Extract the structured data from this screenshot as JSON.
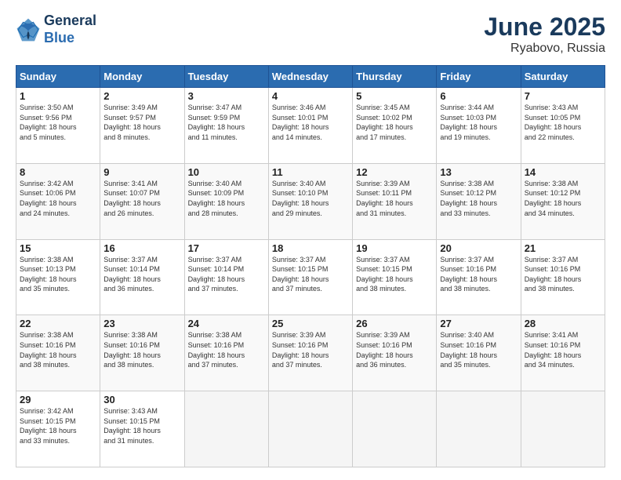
{
  "header": {
    "logo_line1": "General",
    "logo_line2": "Blue",
    "main_title": "June 2025",
    "subtitle": "Ryabovo, Russia"
  },
  "days_of_week": [
    "Sunday",
    "Monday",
    "Tuesday",
    "Wednesday",
    "Thursday",
    "Friday",
    "Saturday"
  ],
  "weeks": [
    [
      {
        "day": "1",
        "sunrise": "3:50 AM",
        "sunset": "9:56 PM",
        "daylight": "18 hours and 5 minutes."
      },
      {
        "day": "2",
        "sunrise": "3:49 AM",
        "sunset": "9:57 PM",
        "daylight": "18 hours and 8 minutes."
      },
      {
        "day": "3",
        "sunrise": "3:47 AM",
        "sunset": "9:59 PM",
        "daylight": "18 hours and 11 minutes."
      },
      {
        "day": "4",
        "sunrise": "3:46 AM",
        "sunset": "10:01 PM",
        "daylight": "18 hours and 14 minutes."
      },
      {
        "day": "5",
        "sunrise": "3:45 AM",
        "sunset": "10:02 PM",
        "daylight": "18 hours and 17 minutes."
      },
      {
        "day": "6",
        "sunrise": "3:44 AM",
        "sunset": "10:03 PM",
        "daylight": "18 hours and 19 minutes."
      },
      {
        "day": "7",
        "sunrise": "3:43 AM",
        "sunset": "10:05 PM",
        "daylight": "18 hours and 22 minutes."
      }
    ],
    [
      {
        "day": "8",
        "sunrise": "3:42 AM",
        "sunset": "10:06 PM",
        "daylight": "18 hours and 24 minutes."
      },
      {
        "day": "9",
        "sunrise": "3:41 AM",
        "sunset": "10:07 PM",
        "daylight": "18 hours and 26 minutes."
      },
      {
        "day": "10",
        "sunrise": "3:40 AM",
        "sunset": "10:09 PM",
        "daylight": "18 hours and 28 minutes."
      },
      {
        "day": "11",
        "sunrise": "3:40 AM",
        "sunset": "10:10 PM",
        "daylight": "18 hours and 29 minutes."
      },
      {
        "day": "12",
        "sunrise": "3:39 AM",
        "sunset": "10:11 PM",
        "daylight": "18 hours and 31 minutes."
      },
      {
        "day": "13",
        "sunrise": "3:38 AM",
        "sunset": "10:12 PM",
        "daylight": "18 hours and 33 minutes."
      },
      {
        "day": "14",
        "sunrise": "3:38 AM",
        "sunset": "10:12 PM",
        "daylight": "18 hours and 34 minutes."
      }
    ],
    [
      {
        "day": "15",
        "sunrise": "3:38 AM",
        "sunset": "10:13 PM",
        "daylight": "18 hours and 35 minutes."
      },
      {
        "day": "16",
        "sunrise": "3:37 AM",
        "sunset": "10:14 PM",
        "daylight": "18 hours and 36 minutes."
      },
      {
        "day": "17",
        "sunrise": "3:37 AM",
        "sunset": "10:14 PM",
        "daylight": "18 hours and 37 minutes."
      },
      {
        "day": "18",
        "sunrise": "3:37 AM",
        "sunset": "10:15 PM",
        "daylight": "18 hours and 37 minutes."
      },
      {
        "day": "19",
        "sunrise": "3:37 AM",
        "sunset": "10:15 PM",
        "daylight": "18 hours and 38 minutes."
      },
      {
        "day": "20",
        "sunrise": "3:37 AM",
        "sunset": "10:16 PM",
        "daylight": "18 hours and 38 minutes."
      },
      {
        "day": "21",
        "sunrise": "3:37 AM",
        "sunset": "10:16 PM",
        "daylight": "18 hours and 38 minutes."
      }
    ],
    [
      {
        "day": "22",
        "sunrise": "3:38 AM",
        "sunset": "10:16 PM",
        "daylight": "18 hours and 38 minutes."
      },
      {
        "day": "23",
        "sunrise": "3:38 AM",
        "sunset": "10:16 PM",
        "daylight": "18 hours and 38 minutes."
      },
      {
        "day": "24",
        "sunrise": "3:38 AM",
        "sunset": "10:16 PM",
        "daylight": "18 hours and 37 minutes."
      },
      {
        "day": "25",
        "sunrise": "3:39 AM",
        "sunset": "10:16 PM",
        "daylight": "18 hours and 37 minutes."
      },
      {
        "day": "26",
        "sunrise": "3:39 AM",
        "sunset": "10:16 PM",
        "daylight": "18 hours and 36 minutes."
      },
      {
        "day": "27",
        "sunrise": "3:40 AM",
        "sunset": "10:16 PM",
        "daylight": "18 hours and 35 minutes."
      },
      {
        "day": "28",
        "sunrise": "3:41 AM",
        "sunset": "10:16 PM",
        "daylight": "18 hours and 34 minutes."
      }
    ],
    [
      {
        "day": "29",
        "sunrise": "3:42 AM",
        "sunset": "10:15 PM",
        "daylight": "18 hours and 33 minutes."
      },
      {
        "day": "30",
        "sunrise": "3:43 AM",
        "sunset": "10:15 PM",
        "daylight": "18 hours and 31 minutes."
      },
      null,
      null,
      null,
      null,
      null
    ]
  ],
  "labels": {
    "sunrise": "Sunrise:",
    "sunset": "Sunset:",
    "daylight": "Daylight:"
  }
}
